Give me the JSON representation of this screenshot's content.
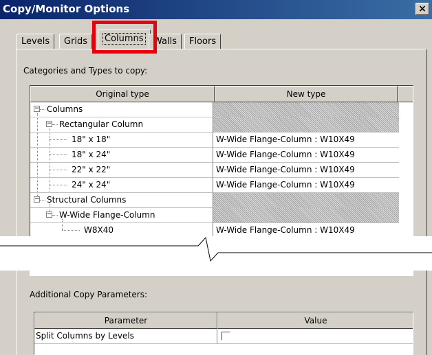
{
  "window": {
    "title": "Copy/Monitor Options",
    "close_label": "×"
  },
  "tabs": [
    {
      "label": "Levels"
    },
    {
      "label": "Grids"
    },
    {
      "label": "Columns",
      "active": true
    },
    {
      "label": "Walls"
    },
    {
      "label": "Floors"
    }
  ],
  "types_section": {
    "label": "Categories and Types to copy:",
    "columns": [
      "Original type",
      "New type"
    ],
    "rows": [
      {
        "original": "Columns",
        "new": ""
      },
      {
        "original": "Rectangular Column",
        "new": ""
      },
      {
        "original": "18\" x 18\"",
        "new": "W-Wide Flange-Column : W10X49"
      },
      {
        "original": "18\" x 24\"",
        "new": "W-Wide Flange-Column : W10X49"
      },
      {
        "original": "22\" x 22\"",
        "new": "W-Wide Flange-Column : W10X49"
      },
      {
        "original": "24\" x 24\"",
        "new": "W-Wide Flange-Column : W10X49"
      },
      {
        "original": "Structural Columns",
        "new": ""
      },
      {
        "original": "W-Wide Flange-Column",
        "new": ""
      },
      {
        "original": "W8X40",
        "new": "W-Wide Flange-Column : W10X49"
      }
    ]
  },
  "params_section": {
    "label": "Additional Copy Parameters:",
    "columns": [
      "Parameter",
      "Value"
    ],
    "rows": [
      {
        "parameter": "Split Columns by Levels",
        "checked": false
      }
    ]
  },
  "colors": {
    "highlight": "#e8000b",
    "titlebar": "#0a246a"
  }
}
